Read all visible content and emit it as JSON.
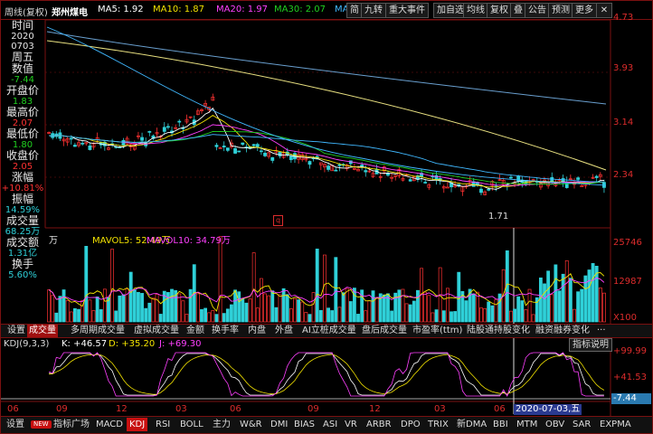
{
  "colors": {
    "up": "#ff3232",
    "down": "#2fd0d8",
    "ma5": "#ffffff",
    "ma10": "#f2e200",
    "ma20": "#ff40ff",
    "ma30": "#20d020",
    "ma60": "#40b8ff",
    "grid": "#7a1010",
    "accent": "#dd2c2c"
  },
  "header": {
    "period": "周线(复权)",
    "stock": "郑州煤电",
    "ma5": "MA5: 1.92",
    "ma10": "MA10: 1.87",
    "ma20": "MA20: 1.97",
    "ma30": "MA30: 2.07",
    "ma60": "MA60",
    "buttons": [
      "简",
      "九转",
      "重大事件",
      "加自选",
      "均线",
      "复权",
      "叠",
      "公告",
      "预测",
      "更多"
    ],
    "close_icon": "close-icon"
  },
  "info_panel": {
    "time_label": "时间",
    "year": "2020",
    "date": "0703",
    "weekday": "周五",
    "value_label": "数值",
    "value": "-7.44",
    "open_label": "开盘价",
    "open": "1.83",
    "high_label": "最高价",
    "high": "2.07",
    "low_label": "最低价",
    "low": "1.80",
    "close_label": "收盘价",
    "close": "2.05",
    "change_label": "涨幅",
    "change": "+10.81%",
    "amp_label": "振幅",
    "amp": "14.59%",
    "vol_label": "成交量",
    "vol": "68.25万",
    "amount_label": "成交额",
    "amount": "1.31亿",
    "turnover_label": "换手",
    "turnover": "5.60%"
  },
  "price_axis": [
    "4.73",
    "3.93",
    "3.14",
    "2.34"
  ],
  "price_low_label": "1.71",
  "volume": {
    "title_suffix": "万",
    "mavol5": "MAVOL5: 52.49万",
    "mavol10": "MAVOL10: 34.79万",
    "axis": [
      "25746",
      "12987",
      "X100"
    ]
  },
  "indicator_tabs": [
    "设置",
    "成交量",
    "多周期成交量",
    "虚拟成交量",
    "金额",
    "换手率",
    "内盘",
    "外盘",
    "AI立桩成交量",
    "盘后成交量",
    "市盈率(ttm)",
    "陆股通持股变化",
    "融资融券变化",
    "···"
  ],
  "kdj": {
    "title": "KDJ(9,3,3)",
    "k": "K: +46.57",
    "d": "D: +35.20",
    "j": "J: +69.30",
    "help": "指标说明",
    "axis": [
      "+99.99",
      "+41.53",
      "-7.44"
    ]
  },
  "time_axis": [
    "06",
    "09",
    "12",
    "03",
    "06",
    "09",
    "12",
    "03",
    "06",
    "09",
    "12",
    "03",
    "06"
  ],
  "cursor_date": "2020-07-03,五",
  "bottom_tabs": [
    "设置",
    "NEW",
    "指标广场",
    "MACD",
    "KDJ",
    "RSI",
    "BOLL",
    "主力",
    "W&R",
    "DMI",
    "BIAS",
    "ASI",
    "VR",
    "ARBR",
    "DPO",
    "TRIX",
    "新DMA",
    "BBI",
    "MTM",
    "OBV",
    "SAR",
    "EXPMA"
  ]
}
